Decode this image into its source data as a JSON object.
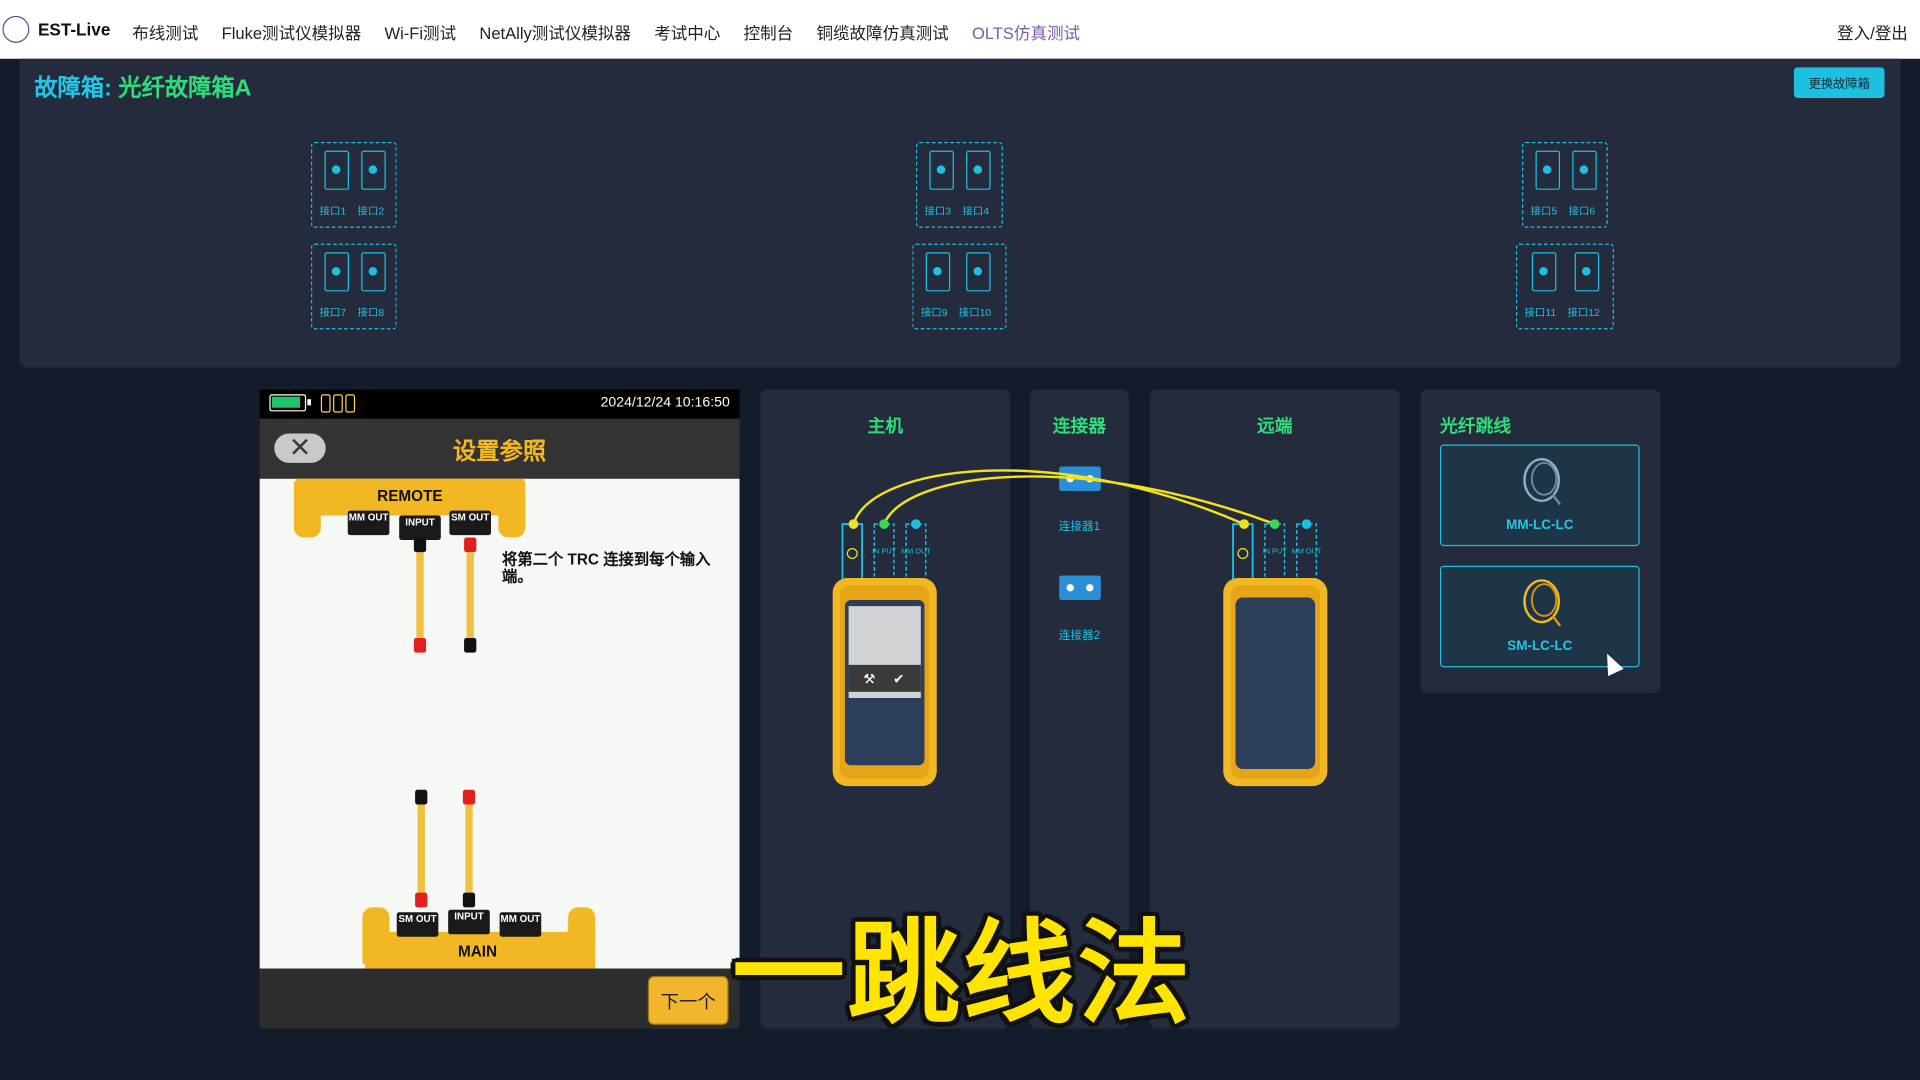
{
  "nav": {
    "brand": "EST-Live",
    "items": [
      {
        "label": "布线测试",
        "active": false
      },
      {
        "label": "Fluke测试仪模拟器",
        "active": false
      },
      {
        "label": "Wi-Fi测试",
        "active": false
      },
      {
        "label": "NetAlly测试仪模拟器",
        "active": false
      },
      {
        "label": "考试中心",
        "active": false
      },
      {
        "label": "控制台",
        "active": false
      },
      {
        "label": "铜缆故障仿真测试",
        "active": false
      },
      {
        "label": "OLTS仿真测试",
        "active": true
      }
    ],
    "login": "登入/登出"
  },
  "fault_box": {
    "title_prefix": "故障箱:",
    "title_value": "光纤故障箱A",
    "swap_button": "更换故障箱",
    "ports": [
      "接口1",
      "接口2",
      "接口3",
      "接口4",
      "接口5",
      "接口6",
      "接口7",
      "接口8",
      "接口9",
      "接口10",
      "接口11",
      "接口12"
    ]
  },
  "tester": {
    "datetime": "2024/12/24 10:16:50",
    "title": "设置参照",
    "instruction": "将第二个 TRC 连接到每个输入端。",
    "remote_label": "REMOTE",
    "main_label": "MAIN",
    "remote_ports": [
      "MM OUT",
      "INPUT",
      "SM OUT"
    ],
    "main_ports": [
      "SM OUT",
      "INPUT",
      "MM OUT"
    ],
    "next_button": "下一个",
    "icons": [
      "close-icon",
      "battery-icon",
      "connection-icon"
    ]
  },
  "host_panel": {
    "title": "主机",
    "port_labels": [
      "IN PUT",
      "MM OUT"
    ]
  },
  "connector_panel": {
    "title": "连接器",
    "items": [
      "连接器1",
      "连接器2"
    ]
  },
  "remote_panel": {
    "title": "远端",
    "port_labels": [
      "IN PUT",
      "MM OUT"
    ]
  },
  "fiber_panel": {
    "title": "光纤跳线",
    "items": [
      "MM-LC-LC",
      "SM-LC-LC"
    ]
  },
  "caption": "一跳线法",
  "colors": {
    "accent": "#1ec0e0",
    "green": "#2edc7a",
    "yellow": "#f2b824",
    "panel": "#232b3c",
    "background": "#141c2c"
  }
}
